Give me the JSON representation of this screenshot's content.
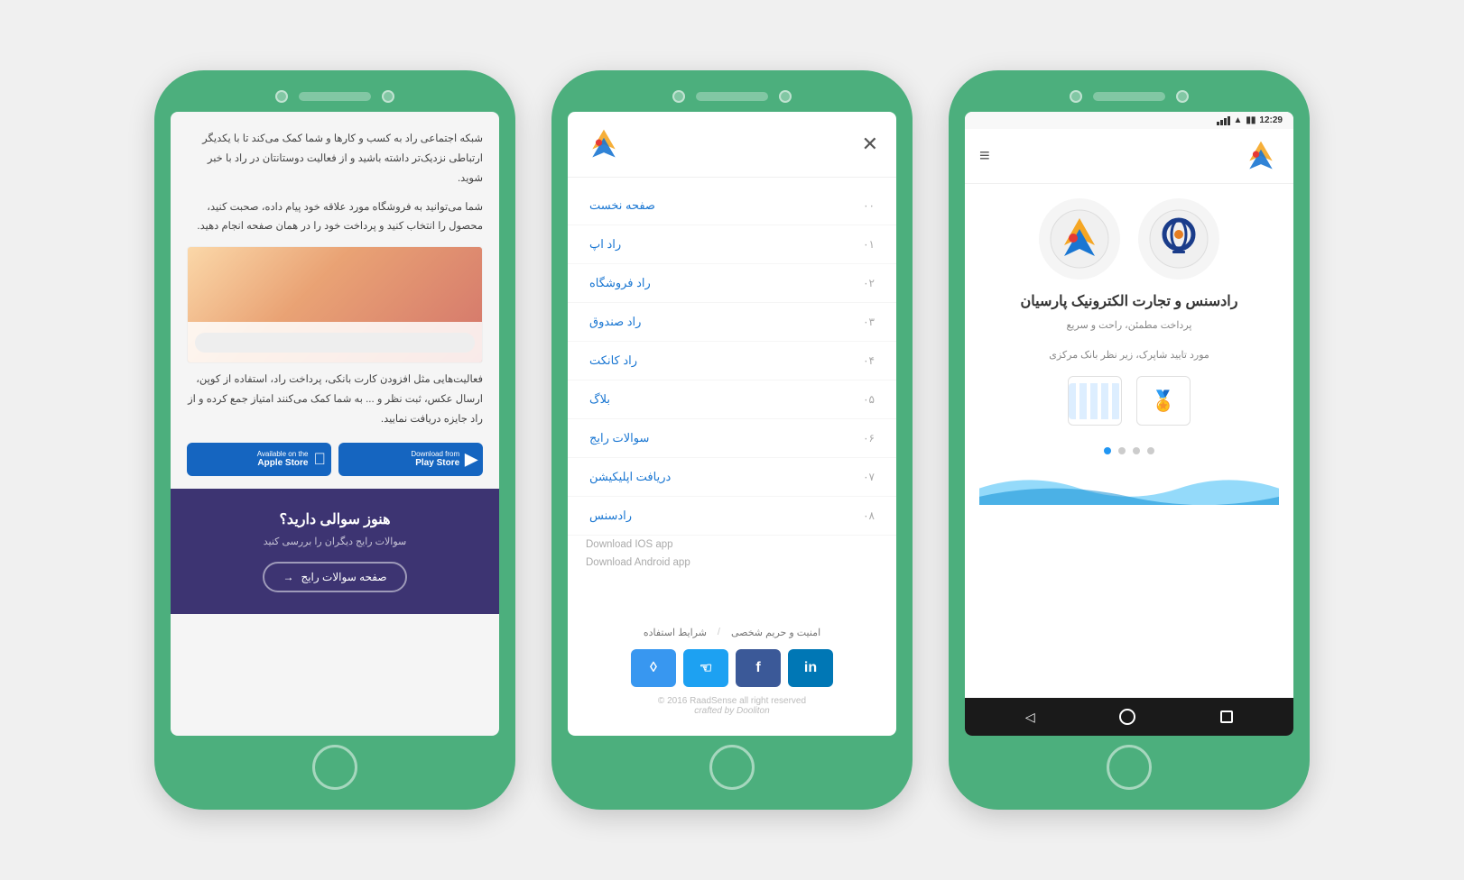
{
  "phone1": {
    "text1": "شبکه اجتماعی راد به کسب و کارها و شما کمک می‌کند تا با یکدیگر ارتباطی نزدیک‌تر داشته باشید و از فعالیت دوستانتان در راد با خبر شوید.",
    "text2": "شما می‌توانید به فروشگاه مورد علاقه خود پیام داده، صحبت کنید، محصول را انتخاب کنید و پرداخت خود را در همان صفحه انجام دهید.",
    "text3": "فعالیت‌هایی مثل افزودن کارت بانکی، پرداخت راد، استفاده از کوپن، ارسال عکس، ثبت نظر و ... به شما کمک می‌کنند امتیاز جمع کرده و از راد جایزه دریافت نمایید.",
    "google_play_label_small": "Download from",
    "google_play_label": "Play Store",
    "apple_store_label_small": "Available on the",
    "apple_store_label": "Apple Store",
    "purple_heading": "هنوز سوالی دارید؟",
    "purple_subtext": "سوالات رایج دیگران را بررسی کنید",
    "faq_btn": "صفحه سوالات رایج"
  },
  "phone2": {
    "close_label": "✕",
    "nav_items": [
      {
        "label": "صفحه نخست",
        "num": "۰۰"
      },
      {
        "label": "راد اپ",
        "num": "۰۱"
      },
      {
        "label": "راد فروشگاه",
        "num": "۰۲"
      },
      {
        "label": "راد صندوق",
        "num": "۰۳"
      },
      {
        "label": "راد کانکت",
        "num": "۰۴"
      },
      {
        "label": "بلاگ",
        "num": "۰۵"
      },
      {
        "label": "سوالات رایج",
        "num": "۰۶"
      },
      {
        "label": "دریافت اپلیکیشن",
        "num": "۰۷"
      },
      {
        "label": "رادسنس",
        "num": "۰۸"
      }
    ],
    "dl_ios": "Download IOS app",
    "dl_android": "Download Android app",
    "footer_link1": "شرایط استفاده",
    "footer_sep": "/",
    "footer_link2": "امنیت و حریم شخصی",
    "copyright": "© 2016 RaadSense all right reserved",
    "crafted": "crafted by Dooliton",
    "social": [
      "instagram",
      "twitter",
      "facebook",
      "linkedin"
    ]
  },
  "phone3": {
    "time": "12:29",
    "title_persian": "رادسنس و تجارت الکترونیک پارسیان",
    "subtitle1": "پرداخت مطمئن، راحت و سریع",
    "subtitle2": "مورد تایید شاپرک، زیر نظر بانک مرکزی"
  }
}
